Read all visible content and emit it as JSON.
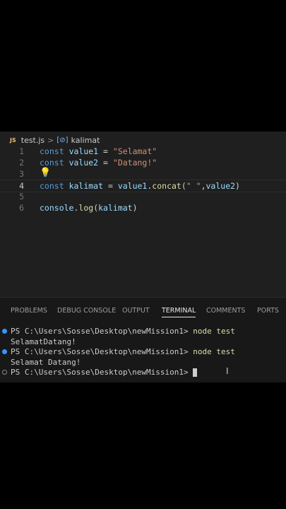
{
  "breadcrumb": {
    "lang_badge": "JS",
    "file": "test.js",
    "separator": ">",
    "symbol_icon": "variable-icon",
    "symbol": "kalimat"
  },
  "lines": [
    {
      "num": "1",
      "tokens": [
        {
          "t": "kw",
          "v": "const"
        },
        {
          "t": "pun",
          "v": " "
        },
        {
          "t": "var",
          "v": "value1"
        },
        {
          "t": "pun",
          "v": " = "
        },
        {
          "t": "str",
          "v": "\"Selamat\""
        }
      ]
    },
    {
      "num": "2",
      "tokens": [
        {
          "t": "kw",
          "v": "const"
        },
        {
          "t": "pun",
          "v": " "
        },
        {
          "t": "var",
          "v": "value2"
        },
        {
          "t": "pun",
          "v": " = "
        },
        {
          "t": "str",
          "v": "\"Datang!\""
        }
      ]
    },
    {
      "num": "3",
      "tokens": []
    },
    {
      "num": "4",
      "tokens": [
        {
          "t": "kw",
          "v": "const"
        },
        {
          "t": "pun",
          "v": " "
        },
        {
          "t": "var",
          "v": "kalimat"
        },
        {
          "t": "pun",
          "v": " = "
        },
        {
          "t": "var",
          "v": "value1"
        },
        {
          "t": "pun",
          "v": "."
        },
        {
          "t": "fn",
          "v": "concat"
        },
        {
          "t": "pun",
          "v": "("
        },
        {
          "t": "str",
          "v": "\" \""
        },
        {
          "t": "pun",
          "v": ","
        },
        {
          "t": "var",
          "v": "value2"
        },
        {
          "t": "pun",
          "v": ")"
        }
      ]
    },
    {
      "num": "5",
      "tokens": []
    },
    {
      "num": "6",
      "tokens": [
        {
          "t": "var",
          "v": "console"
        },
        {
          "t": "pun",
          "v": "."
        },
        {
          "t": "fn",
          "v": "log"
        },
        {
          "t": "pun",
          "v": "("
        },
        {
          "t": "var",
          "v": "kalimat"
        },
        {
          "t": "pun",
          "v": ")"
        }
      ]
    }
  ],
  "lightbulb_icon": "lightbulb-icon",
  "panel": {
    "tabs": [
      "PROBLEMS",
      "DEBUG CONSOLE",
      "OUTPUT",
      "TERMINAL",
      "COMMENTS",
      "PORTS"
    ],
    "active_tab": "TERMINAL"
  },
  "terminal": {
    "prompt": "PS C:\\Users\\Sosse\\Desktop\\newMission1> ",
    "command": "node test",
    "output1": "SelamatDatang!",
    "output2": "Selamat Datang!",
    "colors": {
      "success_dot": "#3794ff"
    }
  }
}
